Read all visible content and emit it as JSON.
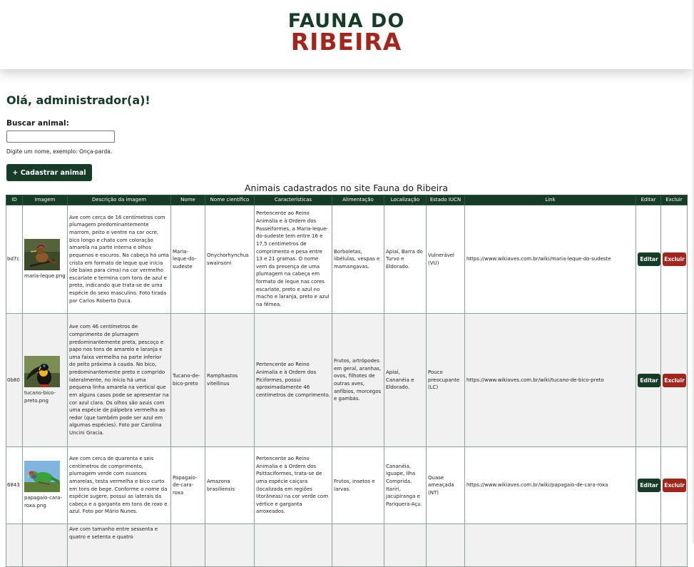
{
  "brand": {
    "line1": "FAUNA DO",
    "line2": "RIBEIRA",
    "color_dark": "#163b27",
    "color_accent": "#a3261c"
  },
  "greeting": "Olá, administrador(a)!",
  "search": {
    "label": "Buscar animal:",
    "value": "",
    "hint": "Digite um nome, exemplo: Onça-parda."
  },
  "add_button": "+ Cadastrar animal",
  "table": {
    "caption": "Animais cadastrados no site Fauna do Ribeira",
    "headers": [
      "ID",
      "Imagem",
      "Descrição da imagem",
      "Nome",
      "Nome científico",
      "Características",
      "Alimentação",
      "Localização",
      "Estado IUCN",
      "Link",
      "Editar",
      "Excluir"
    ],
    "edit_label": "Editar",
    "delete_label": "Excluir",
    "rows": [
      {
        "id": "bd7c",
        "image_file": "maria-leque.png",
        "description": "Ave com cerca de 16 centímetros com plumagem predominantemente marrom, peito e ventre na cor ocre, bico longo e chato com coloração amarela na parte interna e olhos pequenos e escuros. Na cabeça há uma crista em formato de leque que inicia (de baixo para cima) na cor vermelho escarlate e termina com tons de azul e preto, indicando que trata-se de uma espécie do sexo masculino. Foto tirada por Carlos Roberto Duca.",
        "name": "Maria-leque-do-sudeste",
        "scientific": "Onychorhynchus swainsoni",
        "traits": "Pertencente ao Reino Animalia e à Ordem dos Passeiformes, a Maria-leque-do-sudeste tem entre 16 e 17,5 centímetros de comprimento e pesa entre 13 e 21 gramas. O nome vem da presença de uma plumagem na cabeça em formato de leque nas cores escarlate, preto e azul no macho e laranja, preto e azul na fêmea.",
        "diet": "Borboletas, libélulas, vespas e mamangavas.",
        "location": "Apiaí, Barra do Turvo e Eldorado.",
        "iucn": "Vulnerável (VU)",
        "link": "https://www.wikiaves.com.br/wiki/maria-leque-do-sudeste"
      },
      {
        "id": "0b80",
        "image_file": "tucano-bico-preto.png",
        "description": "Ave com 46 centímetros de comprimento de plumagem predominantemente preta, pescoço e papo nos tons de amarelo e laranja e uma faixa vermelha na parte inferior do peito próxima à cauda. No bico, predominantemente preto e comprido lateralmente, no início há uma pequena linha amarela na vertical que em alguns casos pode se apresentar na cor azul clara. Os olhos são azuis com uma espécie de pálpebra vermelha ao redor (que também pode ser azul em algumas espécies). Foto por Carolina Uncini Gracia.",
        "name": "Tucano-de-bico-preto",
        "scientific": "Ramphastos vitellinus",
        "traits": "Pertencente ao Reino Animalia e à Ordem dos Piciformes, possui aproximadamente 46 centímetros de comprimento.",
        "diet": "Frutos, artrópodes em geral, aranhas, ovos, filhotes de outras aves, anfíbios, morcegos e gambás.",
        "location": "Apiaí, Cananéia e Eldorado.",
        "iucn": "Pouco preocupante (LC)",
        "link": "https://www.wikiaves.com.br/wiki/tucano-de-bico-preto"
      },
      {
        "id": "6843",
        "image_file": "papagaio-cara-roxa.png",
        "description": "Ave com cerca de quarenta e seis centímetros de comprimento, plumagem verde com nuances amarelas, testa vermelha e bico curto em tons de bege. Conforme o nome da espécie sugere, possui as laterais da cabeça e a garganta em tons de roxo e azul. Foto por Mário Nunes.",
        "name": "Papagaio-de-cara-roxa",
        "scientific": "Amazona brasiliensis",
        "traits": "Pertencente ao Reino Animalia e à Ordem dos Psittaciformes, trata-se de uma espécie caiçara (localizada em regiões litorâneas) na cor verde com vértice e garganta arroxeados.",
        "diet": "Frutos, insetos e larvas.",
        "location": "Cananéia, Iguape, Ilha Comprida, Itariri, Jacupiranga e Pariquera-Açu.",
        "iucn": "Quase ameaçada (NT)",
        "link": "https://www.wikiaves.com.br/wiki/papagaio-de-cara-roxa"
      },
      {
        "id": "",
        "image_file": "",
        "description": "Ave com tamanho entre sessenta e quatro e setenta e quatro",
        "name": "",
        "scientific": "",
        "traits": "",
        "diet": "",
        "location": "",
        "iucn": "",
        "link": ""
      }
    ]
  }
}
